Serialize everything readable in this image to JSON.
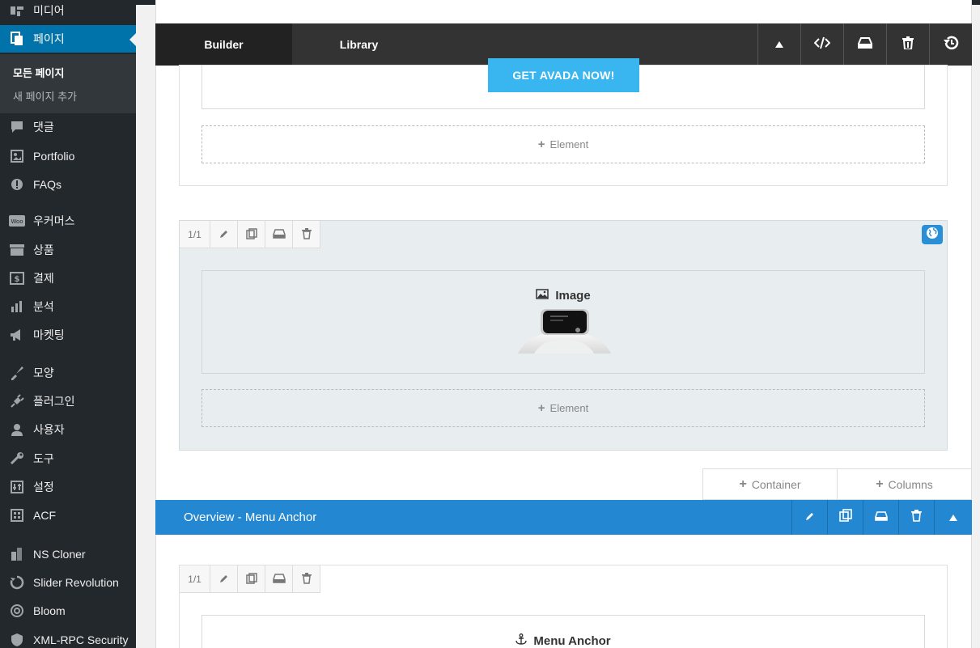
{
  "sidebar": {
    "items": [
      {
        "label": "미디어",
        "icon": "media-icon"
      },
      {
        "label": "페이지",
        "icon": "pages-icon",
        "active": true
      },
      {
        "label": "댓글",
        "icon": "comments-icon"
      },
      {
        "label": "Portfolio",
        "icon": "portfolio-icon"
      },
      {
        "label": "FAQs",
        "icon": "faq-icon"
      },
      {
        "label": "우커머스",
        "icon": "woocommerce-icon"
      },
      {
        "label": "상품",
        "icon": "products-icon"
      },
      {
        "label": "결제",
        "icon": "payments-icon"
      },
      {
        "label": "분석",
        "icon": "analytics-icon"
      },
      {
        "label": "마켓팅",
        "icon": "marketing-icon"
      },
      {
        "label": "모양",
        "icon": "appearance-icon"
      },
      {
        "label": "플러그인",
        "icon": "plugins-icon"
      },
      {
        "label": "사용자",
        "icon": "users-icon"
      },
      {
        "label": "도구",
        "icon": "tools-icon"
      },
      {
        "label": "설정",
        "icon": "settings-icon"
      },
      {
        "label": "ACF",
        "icon": "acf-icon"
      },
      {
        "label": "NS Cloner",
        "icon": "ns-cloner-icon"
      },
      {
        "label": "Slider Revolution",
        "icon": "slider-revolution-icon"
      },
      {
        "label": "Bloom",
        "icon": "bloom-icon"
      },
      {
        "label": "XML-RPC Security",
        "icon": "shield-icon"
      }
    ],
    "submenu": {
      "all_pages": "모든 페이지",
      "add_new": "새 페이지 추가"
    }
  },
  "builder": {
    "tabs": {
      "builder": "Builder",
      "library": "Library"
    }
  },
  "canvas": {
    "cta_label": "GET AVADA NOW!",
    "add_element": "Element",
    "column_fraction": "1/1",
    "image_element_title": "Image",
    "add_container": "Container",
    "add_columns": "Columns",
    "anchor_container_title": "Overview - Menu Anchor",
    "menu_anchor_title": "Menu Anchor"
  },
  "colors": {
    "sidebar_bg": "#23282d",
    "active_menu": "#0073aa",
    "cta": "#39b5f0",
    "anchor_bar": "#2387d2"
  }
}
